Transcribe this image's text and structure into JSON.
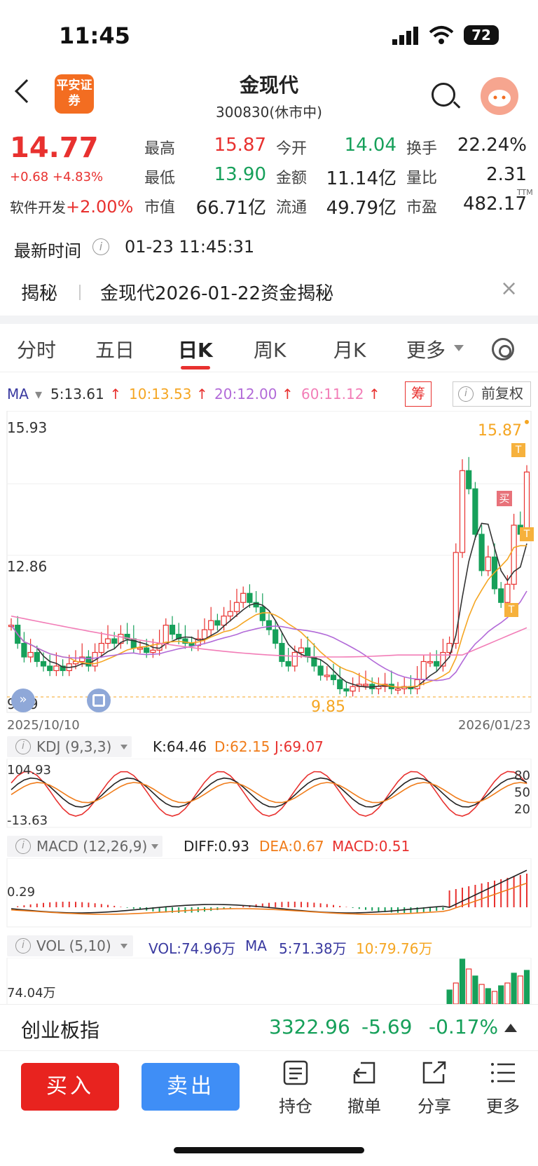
{
  "status_bar": {
    "time": "11:45",
    "battery": "72"
  },
  "header": {
    "broker_logo": "平安证券",
    "title": "金现代",
    "subtitle": "300830(休市中)"
  },
  "quote": {
    "price": "14.77",
    "change": "+0.68 +4.83%",
    "sector_name": "软件开发",
    "sector_change": "+2.00%",
    "fields": [
      {
        "label": "最高",
        "value": "15.87",
        "color": "#e8312f"
      },
      {
        "label": "今开",
        "value": "14.04",
        "color": "#16a05a"
      },
      {
        "label": "换手",
        "value": "22.24%",
        "color": "#222222"
      },
      {
        "label": "最低",
        "value": "13.90",
        "color": "#16a05a"
      },
      {
        "label": "金额",
        "value": "11.14亿",
        "color": "#222222"
      },
      {
        "label": "量比",
        "value": "2.31",
        "color": "#222222"
      },
      {
        "label": "市值",
        "value": "66.71亿",
        "color": "#222222"
      },
      {
        "label": "流通",
        "value": "49.79亿",
        "color": "#222222"
      },
      {
        "label": "市盈",
        "value": "482.17",
        "color": "#222222"
      }
    ],
    "pe_superscript": "TTM",
    "latest_time_label": "最新时间",
    "latest_time": "01-23 11:45:31"
  },
  "jiemi": {
    "label": "揭秘",
    "text": "金现代2026-01-22资金揭秘"
  },
  "tabs": [
    "分时",
    "五日",
    "日K",
    "周K",
    "月K",
    "更多"
  ],
  "active_tab": "日K",
  "ma_row": {
    "label": "MA",
    "items": [
      {
        "text": "5:13.61",
        "color": "#333333"
      },
      {
        "text": "10:13.53",
        "color": "#f5a623"
      },
      {
        "text": "20:12.00",
        "color": "#b26ad8"
      },
      {
        "text": "60:11.12",
        "color": "#f27db7"
      }
    ],
    "chou": "筹",
    "fuquan": "前复权"
  },
  "kline": {
    "y_top": "15.93",
    "y_mid": "12.86",
    "y_low": "9.79",
    "max_label": "15.87",
    "min_label": "9.85",
    "date_start": "2025/10/10",
    "date_end": "2026/01/23",
    "buy_mark": "买",
    "t_mark": "T"
  },
  "kdj": {
    "label": "KDJ (9,3,3)",
    "k": "K:64.46",
    "d": "D:62.15",
    "j": "J:69.07",
    "y_top": "104.93",
    "y_bottom": "-13.63",
    "levels": [
      "80",
      "50",
      "20"
    ]
  },
  "macd": {
    "label": "MACD (12,26,9)",
    "diff": "DIFF:0.93",
    "dea": "DEA:0.67",
    "macd": "MACD:0.51",
    "y_label": "0.29"
  },
  "vol": {
    "label": "VOL (5,10)",
    "vol": "VOL:74.96万",
    "ma": "MA",
    "ma5": "5:71.38万",
    "ma10": "10:79.76万",
    "y_label": "74.04万"
  },
  "index_bar": {
    "name": "创业板指",
    "value": "3322.96",
    "change": "-5.69",
    "pct": "-0.17%"
  },
  "actions": {
    "buy": "买入",
    "sell": "卖出",
    "items": [
      {
        "label": "持仓",
        "icon": "position-icon"
      },
      {
        "label": "撤单",
        "icon": "cancel-order-icon"
      },
      {
        "label": "分享",
        "icon": "share-icon"
      },
      {
        "label": "更多",
        "icon": "more-icon"
      }
    ]
  },
  "colors": {
    "up": "#e8312f",
    "down": "#16a05a",
    "buy": "#e8231f",
    "sell": "#3f8ef6"
  }
}
